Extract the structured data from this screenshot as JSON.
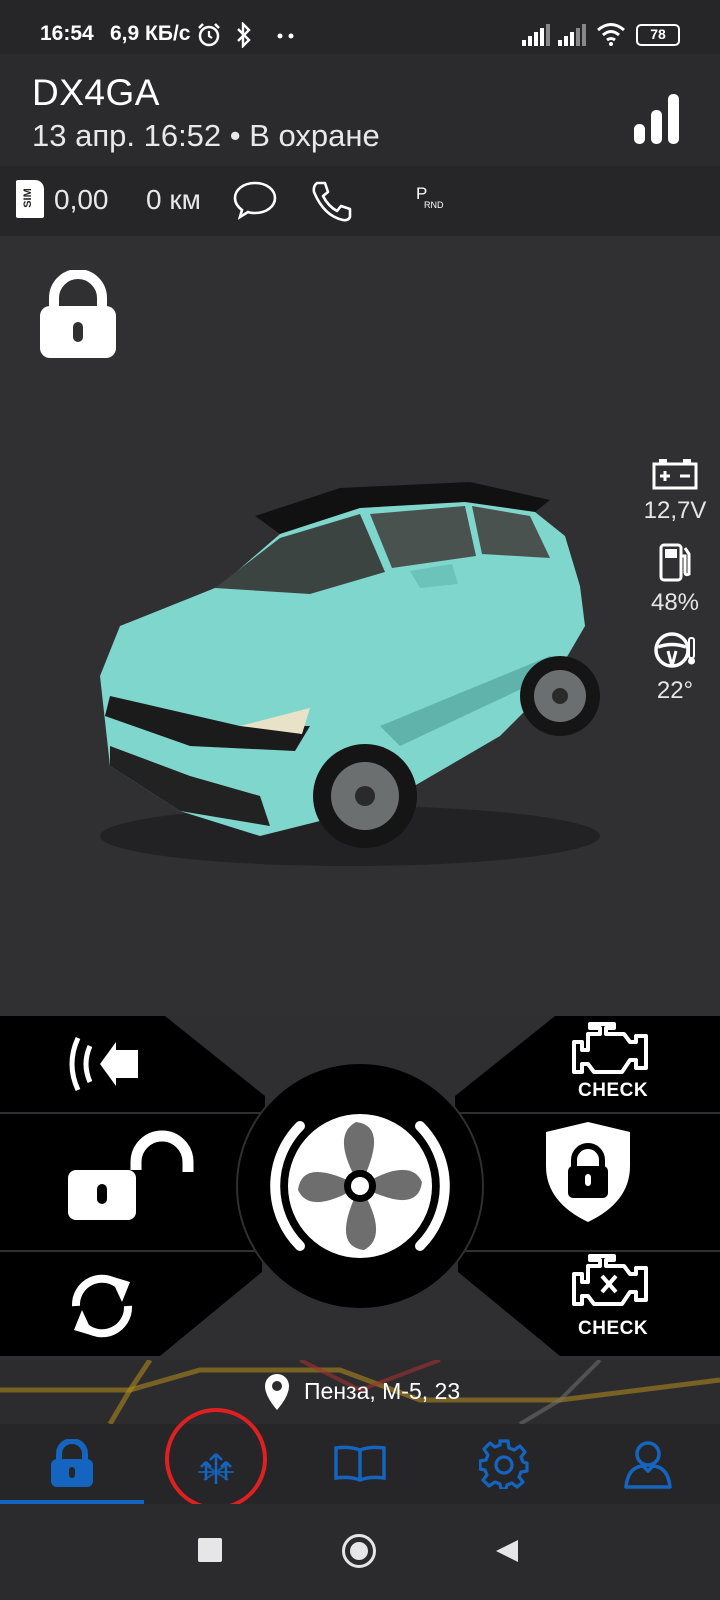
{
  "status_bar": {
    "time": "16:54",
    "speed": "6,9 КБ/с",
    "battery": "78",
    "icons": [
      "alarm-icon",
      "bluetooth-icon",
      "more-dots-icon",
      "signal-icon",
      "signal-icon",
      "wifi-icon",
      "battery-icon"
    ]
  },
  "header": {
    "car_name": "DX4GA",
    "status": "13 апр. 16:52 • В охране"
  },
  "info_bar": {
    "sim_label": "SIM",
    "balance": "0,00",
    "mileage": "0 км",
    "gear_label_top": "P",
    "gear_label_bottom": "RND"
  },
  "sensors": {
    "voltage": "12,7V",
    "fuel": "48%",
    "temperature": "22°"
  },
  "controls": {
    "check_label_top": "CHECK",
    "check_label_bottom": "CHECK"
  },
  "location": {
    "address": "Пенза, М-5, 23"
  },
  "colors": {
    "accent": "#1565c0",
    "car": "#7fd6cc",
    "highlight": "#e02020"
  }
}
